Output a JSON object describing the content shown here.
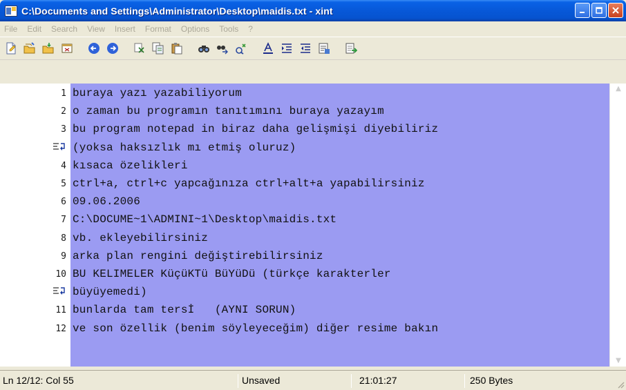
{
  "window": {
    "title": "C:\\Documents and Settings\\Administrator\\Desktop\\maidis.txt - xint"
  },
  "menu": [
    "File",
    "Edit",
    "Search",
    "View",
    "Insert",
    "Format",
    "Options",
    "Tools",
    "?"
  ],
  "toolbar": {
    "icons": [
      "new-file-icon",
      "open-file-icon",
      "save-file-icon",
      "close-file-icon",
      "undo-icon",
      "redo-icon",
      "cut-icon",
      "copy-icon",
      "paste-icon",
      "find-icon",
      "find-next-icon",
      "replace-icon",
      "font-icon",
      "indent-icon",
      "outdent-icon",
      "properties-icon",
      "export-icon"
    ]
  },
  "editor": {
    "background_color": "#9b9bf2",
    "lines": [
      {
        "num": "1",
        "text": "buraya yazı yazabiliyorum"
      },
      {
        "num": "2",
        "text": "o zaman bu programın tanıtımını buraya yazayım"
      },
      {
        "num": "3",
        "text": "bu program notepad in biraz daha gelişmişi diyebiliriz"
      },
      {
        "num": "",
        "wrap": true,
        "text": "(yoksa haksızlık mı etmiş oluruz)"
      },
      {
        "num": "4",
        "text": "kısaca özelikleri"
      },
      {
        "num": "5",
        "text": "ctrl+a, ctrl+c yapcağınıza ctrl+alt+a yapabilirsiniz"
      },
      {
        "num": "6",
        "text": "09.06.2006"
      },
      {
        "num": "7",
        "text": "C:\\DOCUME~1\\ADMINI~1\\Desktop\\maidis.txt"
      },
      {
        "num": "8",
        "text": "vb. ekleyebilirsiniz"
      },
      {
        "num": "9",
        "text": "arka plan rengini değiştirebilirsiniz"
      },
      {
        "num": "10",
        "text": "BU KELIMELER KüçüKTü BüYüDü (türkçe karakterler"
      },
      {
        "num": "",
        "wrap": true,
        "text": "büyüyemedi)"
      },
      {
        "num": "11",
        "text": "bunlarda tam tersİ   (AYNI SORUN)"
      },
      {
        "num": "12",
        "text": "ve son özellik (benim söyleyeceğim) diğer resime bakın"
      }
    ]
  },
  "status": {
    "position": "Ln 12/12: Col 55",
    "saved_state": "Unsaved",
    "time": "21:01:27",
    "size": "250 Bytes"
  }
}
